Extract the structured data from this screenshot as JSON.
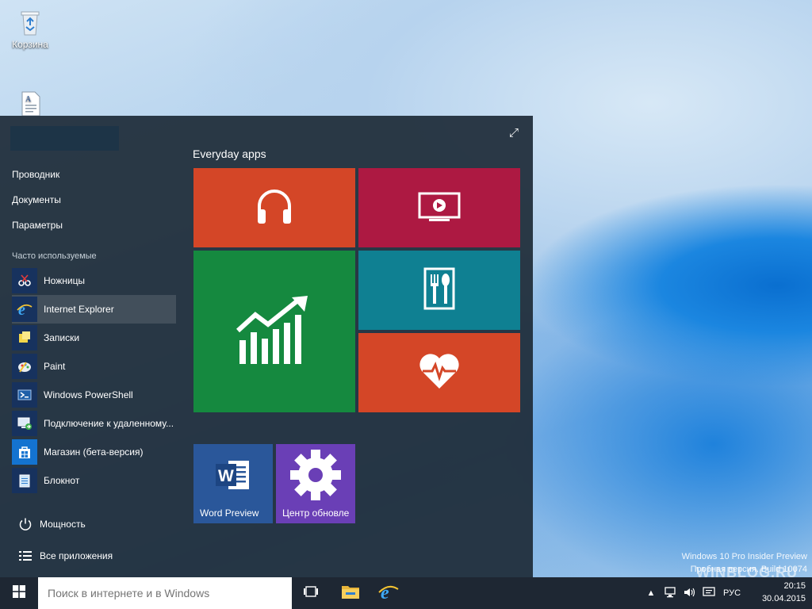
{
  "desktop": {
    "icons": [
      {
        "label": "Корзина",
        "icon": "recycle-bin-icon"
      },
      {
        "label": "",
        "icon": "document-icon"
      }
    ],
    "watermark": {
      "line1": "Windows 10 Pro Insider Preview",
      "line2": "Пробная версия. Build 10074"
    },
    "brand": "WINBLOG.RU"
  },
  "start_menu": {
    "places": [
      "Проводник",
      "Документы",
      "Параметры"
    ],
    "frequent_label": "Часто используемые",
    "apps": [
      {
        "label": "Ножницы",
        "icon": "scissors-icon"
      },
      {
        "label": "Internet Explorer",
        "icon": "internet-explorer-icon"
      },
      {
        "label": "Записки",
        "icon": "sticky-notes-icon"
      },
      {
        "label": "Paint",
        "icon": "paint-icon"
      },
      {
        "label": "Windows PowerShell",
        "icon": "powershell-icon"
      },
      {
        "label": "Подключение к удаленному...",
        "icon": "remote-desktop-icon"
      },
      {
        "label": "Магазин (бета-версия)",
        "icon": "store-icon"
      },
      {
        "label": "Блокнот",
        "icon": "notepad-icon"
      }
    ],
    "power_label": "Мощность",
    "all_apps_label": "Все приложения",
    "group_title": "Everyday apps",
    "tiles": {
      "word": {
        "label": "Word Preview"
      },
      "update": {
        "label": "Центр обновле"
      }
    },
    "colors": {
      "music": "#d44627",
      "video": "#ad1942",
      "money": "#15893f",
      "food": "#0f8092",
      "health": "#d44627",
      "word": "#2a579a",
      "update": "#6a3fb6"
    }
  },
  "taskbar": {
    "search_placeholder": "Поиск в интернете и в Windows",
    "lang": "РУС",
    "time": "20:15",
    "date": "30.04.2015"
  }
}
